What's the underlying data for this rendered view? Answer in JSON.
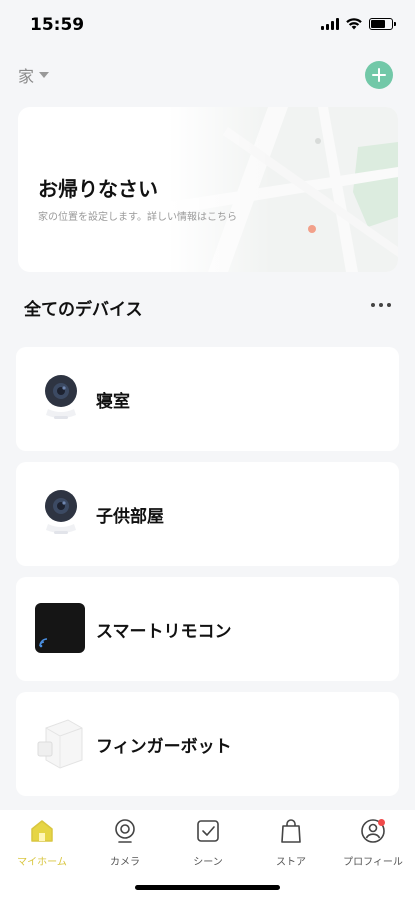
{
  "status_bar": {
    "time": "15:59"
  },
  "header": {
    "home_name": "家"
  },
  "welcome": {
    "title": "お帰りなさい",
    "subtitle": "家の位置を設定します。詳しい情報はこちら"
  },
  "devices_section": {
    "title": "全てのデバイス"
  },
  "devices": [
    {
      "name": "寝室",
      "icon": "camera-icon"
    },
    {
      "name": "子供部屋",
      "icon": "camera-icon"
    },
    {
      "name": "スマートリモコン",
      "icon": "remote-hub-icon"
    },
    {
      "name": "フィンガーボット",
      "icon": "fingerbot-icon"
    }
  ],
  "tabs": [
    {
      "label": "マイホーム",
      "icon": "home-icon",
      "active": true
    },
    {
      "label": "カメラ",
      "icon": "camera-tab-icon",
      "active": false
    },
    {
      "label": "シーン",
      "icon": "scene-check-icon",
      "active": false
    },
    {
      "label": "ストア",
      "icon": "shopping-bag-icon",
      "active": false
    },
    {
      "label": "プロフィール",
      "icon": "profile-icon",
      "active": false,
      "badge": true
    }
  ],
  "colors": {
    "accent_green": "#72c8a8",
    "active_tab": "#d9c640",
    "badge_red": "#f04a4a",
    "map_pin": "#f2a08a"
  }
}
